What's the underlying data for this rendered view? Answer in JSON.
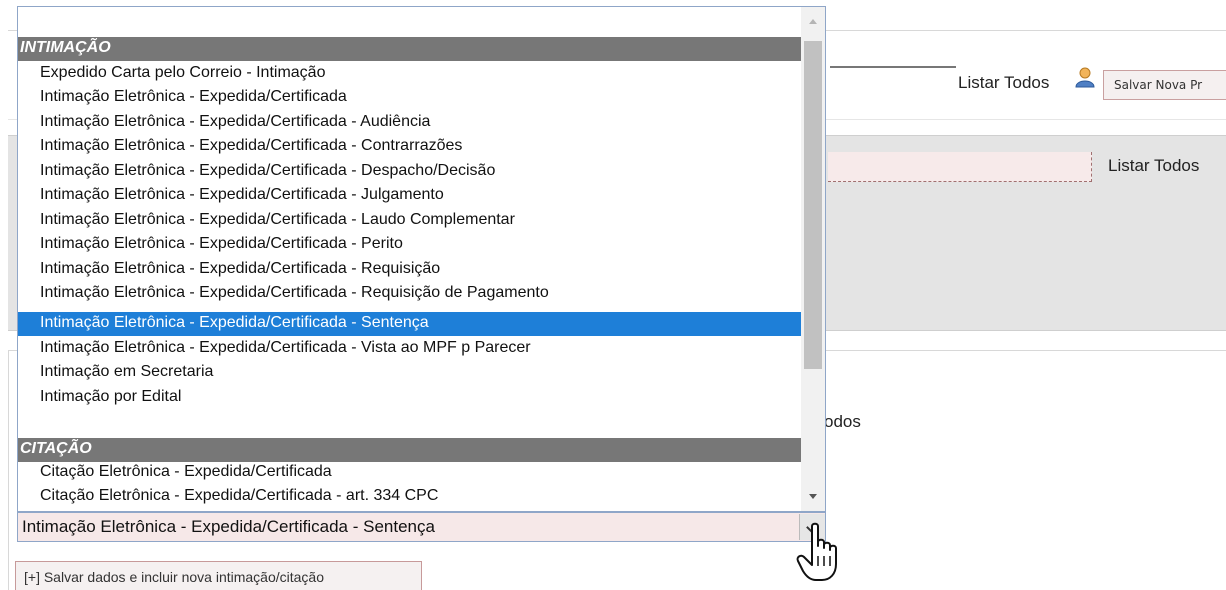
{
  "top_bar": {
    "listar_todos_label": "Listar Todos",
    "salvar_processo_label": "Salvar Nova Pr",
    "user_icon": "user-icon"
  },
  "mid_panel": {
    "listar_todos_label": "Listar Todos"
  },
  "bottom_panel": {
    "listar_todos_partial": "odos"
  },
  "select": {
    "selected_value": "Intimação Eletrônica - Expedida/Certificada - Sentença",
    "groups": [
      {
        "label": "INTIMAÇÃO",
        "options": [
          "Expedido Carta pelo Correio - Intimação",
          "Intimação Eletrônica - Expedida/Certificada",
          "Intimação Eletrônica - Expedida/Certificada - Audiência",
          "Intimação Eletrônica - Expedida/Certificada - Contrarrazões",
          "Intimação Eletrônica - Expedida/Certificada - Despacho/Decisão",
          "Intimação Eletrônica - Expedida/Certificada - Julgamento",
          "Intimação Eletrônica - Expedida/Certificada - Laudo Complementar",
          "Intimação Eletrônica - Expedida/Certificada - Perito",
          "Intimação Eletrônica - Expedida/Certificada - Requisição",
          "Intimação Eletrônica - Expedida/Certificada - Requisição de Pagamento",
          "Intimação Eletrônica - Expedida/Certificada - Sentença",
          "Intimação Eletrônica - Expedida/Certificada - Vista ao MPF p Parecer",
          "Intimação em Secretaria",
          "Intimação por Edital"
        ]
      },
      {
        "label": "CITAÇÃO",
        "options": [
          "Citação Eletrônica - Expedida/Certificada",
          "Citação Eletrônica - Expedida/Certificada - art. 334 CPC"
        ]
      }
    ]
  },
  "buttons": {
    "incluir_label": "[+] Salvar dados e incluir nova intimação/citação"
  },
  "colors": {
    "selected_bg": "#1e7fd8",
    "group_bg": "#777777",
    "field_bg": "#f6e8e8"
  }
}
